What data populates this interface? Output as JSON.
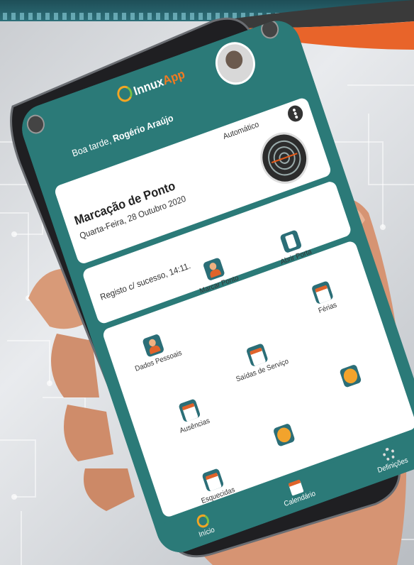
{
  "app": {
    "name_left": "Innux",
    "name_right": "App"
  },
  "header": {
    "greeting": "Boa tarde,",
    "user_name": "Rogério Araújo"
  },
  "punch_card": {
    "mode_label": "Automático",
    "title": "Marcação de Ponto",
    "date": "Quarta-Feira, 28 Outubro 2020"
  },
  "status": {
    "text": "Registo c/ sucesso, 14:11."
  },
  "tiles": [
    {
      "label": "Dados Pessoais",
      "icon": "person-icon"
    },
    {
      "label": "Marcar Ponto",
      "icon": "clock-in-icon"
    },
    {
      "label": "Abrir Porta",
      "icon": "door-icon"
    },
    {
      "label": "Férias",
      "icon": "calendar-icon"
    },
    {
      "label": "Saídas de Serviço",
      "icon": "calendar-icon"
    },
    {
      "label": "Ausências",
      "icon": "calendar-icon"
    },
    {
      "label": "Esquecidas",
      "icon": "calendar-icon"
    },
    {
      "label": "",
      "icon": "person-orange-icon"
    },
    {
      "label": "",
      "icon": "person-orange-icon"
    }
  ],
  "footer_nav": [
    {
      "label": "Início",
      "icon": "home-icon"
    },
    {
      "label": "Calendário",
      "icon": "calendar-icon"
    },
    {
      "label": "Definições",
      "icon": "settings-icon"
    }
  ],
  "colors": {
    "primary": "#2b7a78",
    "accent": "#f47a20",
    "card": "#ffffff"
  }
}
